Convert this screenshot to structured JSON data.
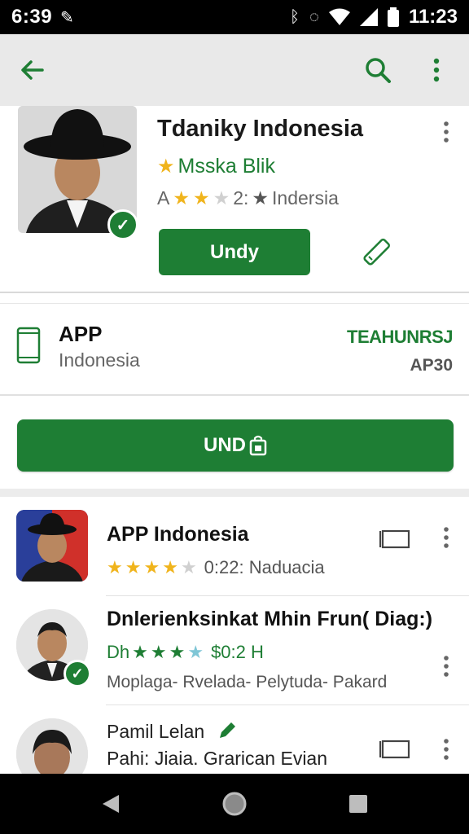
{
  "status_bar": {
    "time": "6:39",
    "clock": "11:23"
  },
  "hero": {
    "title": "Tdaniky Indonesia",
    "subtitle": "Msska Blik",
    "rating_prefix": "A",
    "rating_value": "2:",
    "rating_tail": "Indersia",
    "button_label": "Undy"
  },
  "info": {
    "title": "APP",
    "subtitle": "Indonesia",
    "right_top": "TEAHUNRSJ",
    "right_bottom": "AP30"
  },
  "main_button": {
    "label": "UND"
  },
  "list": [
    {
      "title": "APP Indonesia",
      "rating_text": "0:22: Naduacia"
    },
    {
      "title": "Dnlerienksinkat Mhin Frun( Diag:)",
      "rating_prefix": "Dh",
      "price": "$0:2 H",
      "desc": "Moplaga- Rvelada- Pelytuda- Pakard"
    },
    {
      "title": "Pamil Lelan",
      "line2": "Pahi: Jiaia. Grarican Evian"
    }
  ],
  "colors": {
    "brand_green": "#1e7e34",
    "star_gold": "#f0b41c",
    "app_bar_bg": "#e9e9e9"
  },
  "icons": {
    "back": "arrow-back-icon",
    "search": "search-icon",
    "more": "more-vert-icon",
    "edit": "pencil-icon",
    "ticket": "ticket-icon",
    "phone": "phone-icon",
    "check": "check-badge-icon"
  }
}
